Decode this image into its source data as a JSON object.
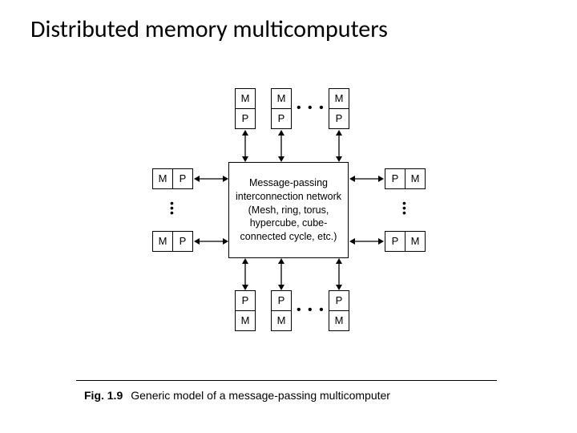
{
  "title": "Distributed memory multicomputers",
  "node": {
    "m": "M",
    "p": "P"
  },
  "center": {
    "line1": "Message-passing",
    "line2": "interconnection network",
    "line3": "(Mesh, ring, torus,",
    "line4": "hypercube, cube-",
    "line5": "connected cycle, etc.)"
  },
  "dots_h": "• • •",
  "dots_v": "•",
  "caption": {
    "label": "Fig. 1.9",
    "text": "Generic model of a message-passing multicomputer"
  }
}
